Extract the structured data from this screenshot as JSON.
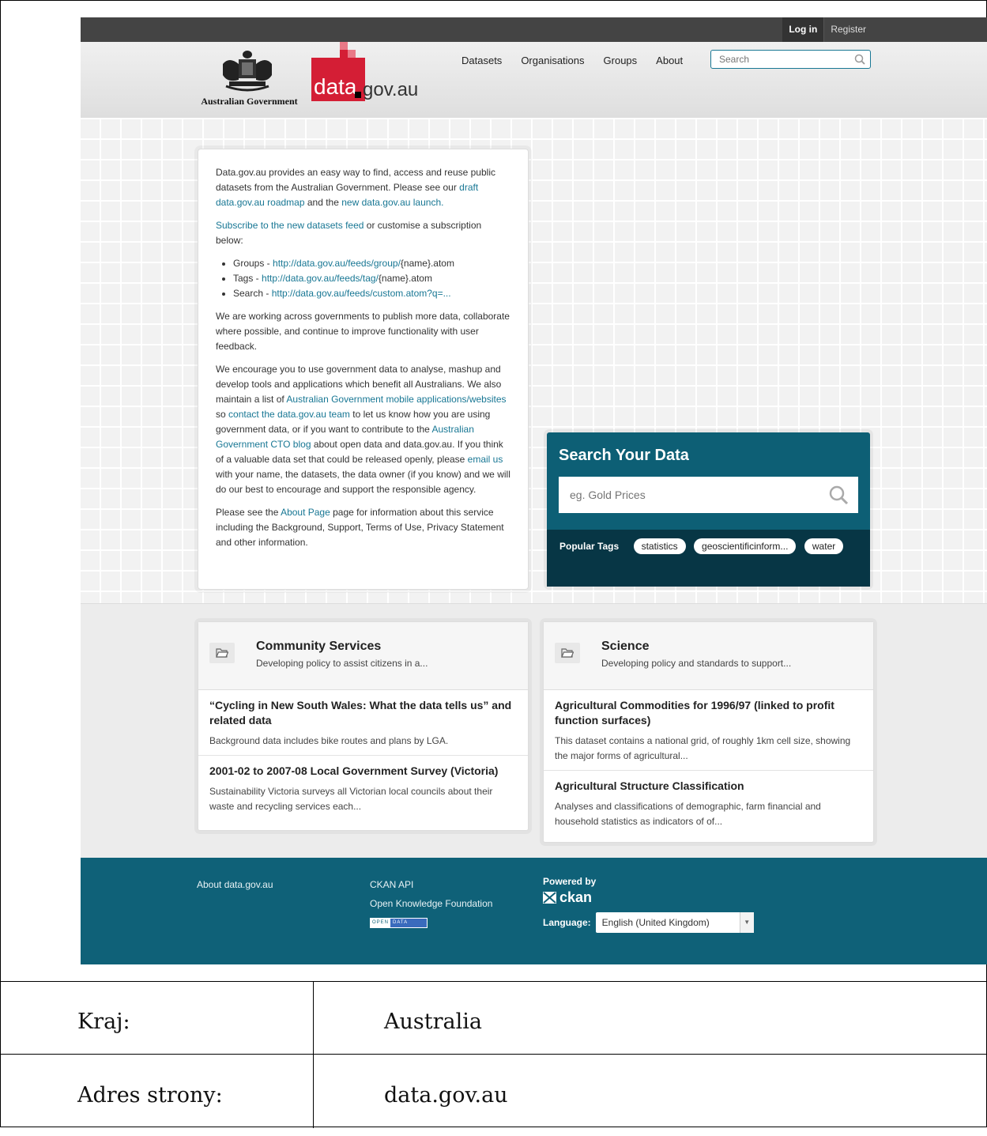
{
  "account": {
    "login": "Log in",
    "register": "Register"
  },
  "logos": {
    "government_text": "Australian Government",
    "data_word": "data",
    "gov_word": "gov.au"
  },
  "nav": {
    "items": [
      "Datasets",
      "Organisations",
      "Groups",
      "About"
    ],
    "search_placeholder": "Search"
  },
  "intro": {
    "p1_text": "Data.gov.au provides an easy way to find, access and reuse public datasets from the Australian Government. Please see our ",
    "p1_link1": "draft data.gov.au roadmap",
    "p1_and": " and the ",
    "p1_link2": "new data.gov.au launch.",
    "p2_link": "Subscribe to the new datasets feed",
    "p2_text": " or customise a subscription below:",
    "feeds": [
      {
        "label": "Groups - ",
        "url": "http://data.gov.au/feeds/group/",
        "suffix": "{name}.atom"
      },
      {
        "label": "Tags - ",
        "url": "http://data.gov.au/feeds/tag/",
        "suffix": "{name}.atom"
      },
      {
        "label": "Search - ",
        "url": "http://data.gov.au/feeds/custom.atom?q=...",
        "suffix": ""
      }
    ],
    "p3": "We are working across governments to publish more data, collaborate where possible, and continue to improve functionality with user feedback.",
    "p4_a": "We encourage you to use government data to analyse, mashup and develop tools and applications which benefit all Australians. We also maintain a list of ",
    "p4_link1": "Australian Government mobile applications/websites",
    "p4_b": " so ",
    "p4_link2": "contact the data.gov.au team",
    "p4_c": " to let us know how you are using government data, or if you want to contribute to the ",
    "p4_link3": "Australian Government CTO blog",
    "p4_d": " about open data and data.gov.au. If you think of a valuable data set that could be released openly, please ",
    "p4_link4": "email us",
    "p4_e": " with your name, the datasets, the data owner (if you know) and we will do our best to encourage and support the responsible agency.",
    "p5_a": "Please see the ",
    "p5_link": "About Page",
    "p5_b": " page for information about this service including the Background, Support, Terms of Use, Privacy Statement and other information."
  },
  "search_panel": {
    "title": "Search Your Data",
    "placeholder": "eg. Gold Prices",
    "tags_label": "Popular Tags",
    "tags": [
      "statistics",
      "geoscientificinform...",
      "water"
    ]
  },
  "groups": [
    {
      "title": "Community Services",
      "desc": "Developing policy to assist citizens in a...",
      "items": [
        {
          "title": "“Cycling in New South Wales: What the data tells us” and related data",
          "desc": "Background data includes bike routes and plans by LGA."
        },
        {
          "title": "2001-02 to 2007-08 Local Government Survey (Victoria)",
          "desc": "Sustainability Victoria surveys all Victorian local councils about their waste and recycling services each..."
        }
      ]
    },
    {
      "title": "Science",
      "desc": "Developing policy and standards to support...",
      "items": [
        {
          "title": "Agricultural Commodities for 1996/97 (linked to profit function surfaces)",
          "desc": "This dataset contains a national grid, of roughly 1km cell size, showing the major forms of agricultural..."
        },
        {
          "title": "Agricultural Structure Classification",
          "desc": "Analyses and classifications of demographic, farm financial and household statistics as indicators of of..."
        }
      ]
    }
  ],
  "footer": {
    "about": "About data.gov.au",
    "ckan_api": "CKAN API",
    "okf": "Open Knowledge Foundation",
    "open_badge_1": "OPEN",
    "open_badge_2": "DATA",
    "powered_by": "Powered by",
    "ckan": "ckan",
    "language_label": "Language:",
    "language_value": "English (United Kingdom)"
  },
  "info_table": {
    "country_label": "Kraj:",
    "country_value": "Australia",
    "address_label": "Adres strony:",
    "address_value": "data.gov.au"
  },
  "colors": {
    "link": "#187794",
    "teal_panel": "#0d5f75",
    "footer": "#0f6178",
    "logo_red": "#d41e35"
  }
}
